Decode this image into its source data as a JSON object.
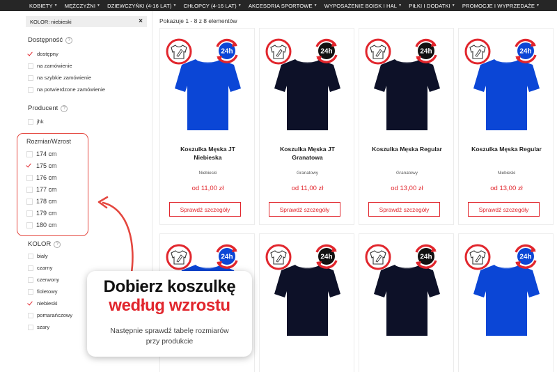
{
  "nav": {
    "items": [
      {
        "label": "KOBIETY"
      },
      {
        "label": "MĘŻCZYŹNI"
      },
      {
        "label": "DZIEWCZYŃKI (4-16 LAT)"
      },
      {
        "label": "CHŁOPCY (4-16 LAT)"
      },
      {
        "label": "AKCESORIA SPORTOWE"
      },
      {
        "label": "WYPOSAŻENIE BOISK I HAL"
      },
      {
        "label": "PIŁKI I DODATKI"
      },
      {
        "label": "PROMOCJE I WYPRZEDAŻE"
      }
    ],
    "caret": "▼"
  },
  "filters": {
    "active_chip": "KOLOR: niebieski",
    "chip_close": "×",
    "availability": {
      "title": "Dostępność",
      "options": [
        {
          "label": "dostępny",
          "checked": true
        },
        {
          "label": "na zamówienie",
          "checked": false
        },
        {
          "label": "na szybkie zamówienie",
          "checked": false
        },
        {
          "label": "na potwierdzone zamówienie",
          "checked": false
        }
      ]
    },
    "producer": {
      "title": "Producent",
      "options": [
        {
          "label": "jhk",
          "checked": false
        }
      ]
    },
    "size": {
      "title": "Rozmiar/Wzrost",
      "options": [
        {
          "label": "174 cm",
          "checked": false
        },
        {
          "label": "175 cm",
          "checked": true
        },
        {
          "label": "176 cm",
          "checked": false
        },
        {
          "label": "177 cm",
          "checked": false
        },
        {
          "label": "178 cm",
          "checked": false
        },
        {
          "label": "179 cm",
          "checked": false
        },
        {
          "label": "180 cm",
          "checked": false
        }
      ]
    },
    "color": {
      "title": "KOLOR",
      "options": [
        {
          "label": "biały",
          "checked": false
        },
        {
          "label": "czarny",
          "checked": false
        },
        {
          "label": "czerwony",
          "checked": false
        },
        {
          "label": "fioletowy",
          "checked": false
        },
        {
          "label": "niebieski",
          "checked": true
        },
        {
          "label": "pomarańczowy",
          "checked": false
        },
        {
          "label": "szary",
          "checked": false
        }
      ]
    },
    "help_glyph": "?"
  },
  "results_text": "Pokazuje 1 - 8 z 8 elementów",
  "badge_text": "24h",
  "products": [
    {
      "name": "Koszulka Męska JT Niebieska",
      "color": "Niebieski",
      "price": "od 11,00 zł",
      "button": "Sprawdź szczegóły",
      "shirt_color": "#0b46d6"
    },
    {
      "name": "Koszulka Męska JT Granatowa",
      "color": "Granatowy",
      "price": "od 11,00 zł",
      "button": "Sprawdź szczegóły",
      "shirt_color": "#0d1128"
    },
    {
      "name": "Koszulka Męska Regular",
      "color": "Granatowy",
      "price": "od 13,00 zł",
      "button": "Sprawdź szczegóły",
      "shirt_color": "#0d1128"
    },
    {
      "name": "Koszulka Męska Regular",
      "color": "Niebieski",
      "price": "od 13,00 zł",
      "button": "Sprawdź szczegóły",
      "shirt_color": "#0b46d6"
    },
    {
      "shirt_color": "#0b46d6"
    },
    {
      "shirt_color": "#0d1128"
    },
    {
      "shirt_color": "#0d1128"
    },
    {
      "shirt_color": "#0b46d6"
    }
  ],
  "tooltip": {
    "line1": "Dobierz koszulkę",
    "line2": "według wzrostu",
    "line3": "Następnie sprawdź tabelę rozmiarów",
    "line4": "przy produkcie"
  },
  "colors": {
    "accent": "#e1262d",
    "nav_bg": "#262626",
    "blue_shirt": "#0b46d6",
    "navy_shirt": "#0d1128"
  }
}
